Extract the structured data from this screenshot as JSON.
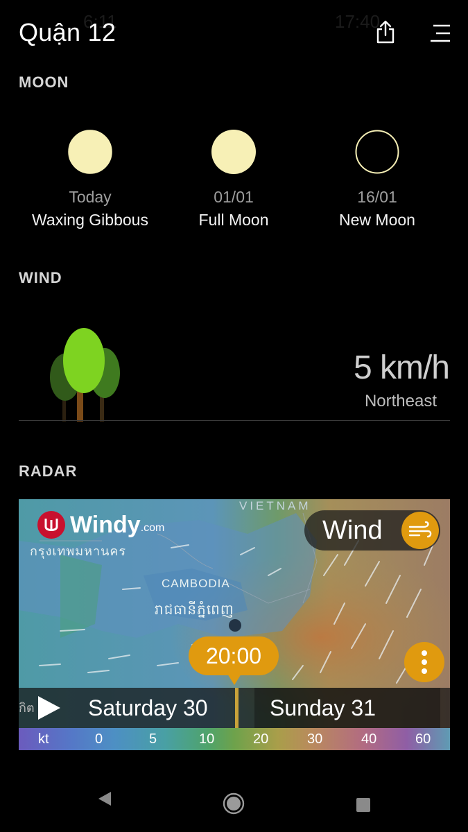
{
  "status": {
    "left_time": "6:11",
    "right_time": "17:40"
  },
  "header": {
    "title": "Quận 12",
    "share_icon": "share-icon",
    "menu_icon": "menu-icon"
  },
  "moon": {
    "section_label": "MOON",
    "phases": [
      {
        "date": "Today",
        "name": "Waxing Gibbous",
        "icon": "waxing-gibbous-moon-icon"
      },
      {
        "date": "01/01",
        "name": "Full Moon",
        "icon": "full-moon-icon"
      },
      {
        "date": "16/01",
        "name": "New Moon",
        "icon": "new-moon-icon"
      }
    ]
  },
  "wind": {
    "section_label": "WIND",
    "speed": "5 km/h",
    "direction": "Northeast"
  },
  "radar": {
    "section_label": "RADAR",
    "brand": "Windy",
    "brand_suffix": ".com",
    "map_labels": {
      "bangkok": "กรุงเทพมหานคร",
      "vietnam": "VIETNAM",
      "cambodia": "CAMBODIA",
      "phnom_penh": "រាជធានីភ្នំពេញ",
      "partial": "กิต"
    },
    "layer_button": "Wind",
    "time": "20:00",
    "days": [
      "Saturday 30",
      "Sunday 31"
    ],
    "legend": {
      "unit": "kt",
      "values": [
        "0",
        "5",
        "10",
        "20",
        "30",
        "40",
        "60"
      ]
    }
  },
  "colors": {
    "accent": "#e09a0f",
    "moon": "#f7f0b6",
    "background": "#000000"
  }
}
